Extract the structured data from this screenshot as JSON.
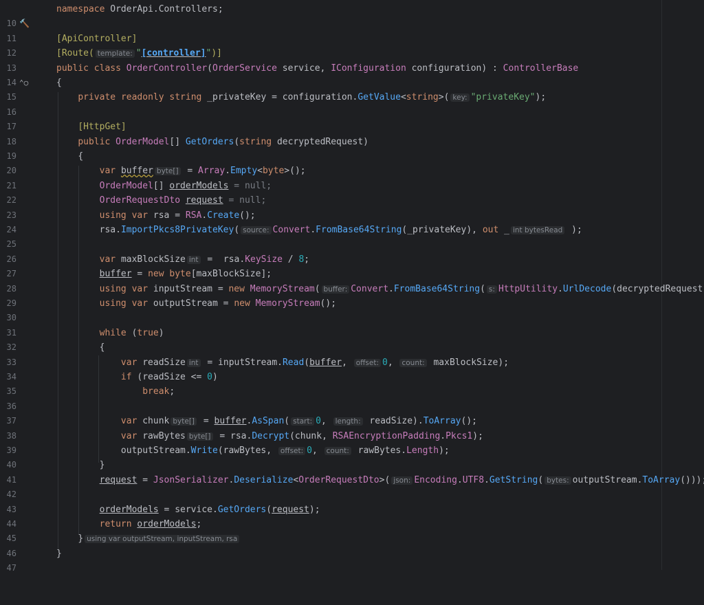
{
  "lines": [
    {
      "n": "10"
    },
    {
      "n": "11"
    },
    {
      "n": "12"
    },
    {
      "n": "13"
    },
    {
      "n": "14"
    },
    {
      "n": "15"
    },
    {
      "n": "16"
    },
    {
      "n": "17"
    },
    {
      "n": "18"
    },
    {
      "n": "19"
    },
    {
      "n": "20"
    },
    {
      "n": "21"
    },
    {
      "n": "22"
    },
    {
      "n": "23"
    },
    {
      "n": "24"
    },
    {
      "n": "25"
    },
    {
      "n": "26"
    },
    {
      "n": "27"
    },
    {
      "n": "28"
    },
    {
      "n": "29"
    },
    {
      "n": "30"
    },
    {
      "n": "31"
    },
    {
      "n": "32"
    },
    {
      "n": "33"
    },
    {
      "n": "34"
    },
    {
      "n": "35"
    },
    {
      "n": "36"
    },
    {
      "n": "37"
    },
    {
      "n": "38"
    },
    {
      "n": "39"
    },
    {
      "n": "40"
    },
    {
      "n": "41"
    },
    {
      "n": "42"
    },
    {
      "n": "43"
    },
    {
      "n": "44"
    },
    {
      "n": "45"
    },
    {
      "n": "46"
    },
    {
      "n": "47"
    }
  ],
  "icons": {
    "hammer": "hammer-icon",
    "override": "override-gutter-icon"
  },
  "t": {
    "namespace": "namespace",
    "ns_name": "OrderApi.Controllers",
    "semi": ";",
    "apicontroller": "[ApiController]",
    "route_open": "[Route(",
    "h_template": "template:",
    "route_str_q1": "\"",
    "route_str": "[controller]",
    "route_str_q2": "\"",
    "route_close": ")]",
    "public": "public",
    "class": "class",
    "controller": "OrderController",
    "p1": "(",
    "orderservice": "OrderService",
    "service": " service, ",
    "iconfig": "IConfiguration",
    "configuration": " configuration) : ",
    "controllerbase": "ControllerBase",
    "brace_open": "{",
    "brace_close": "}",
    "private": "private",
    "readonly": "readonly",
    "string": "string",
    "privkey_field": " _privateKey = configuration.",
    "getvalue": "GetValue",
    "lt": "<",
    "gt": ">(",
    "h_key": "key:",
    "privkey_str": "\"privateKey\"",
    "paren_semi": ");",
    "httpget": "[HttpGet]",
    "ordermodel": "OrderModel",
    "arr": "[] ",
    "getorders": "GetOrders",
    "string2": "string",
    "decrypted_param": " decryptedRequest)",
    "var": "var",
    "buffer": "buffer",
    "h_bytearr": "byte[]",
    "eq": " = ",
    "array": "Array",
    "empty": "Empty",
    "byte": "byte",
    "close_gen": ">();",
    "ordermodels": "orderModels",
    "eq_null": " = null;",
    "orderrequestdto": "OrderRequestDto",
    "request": "request",
    "using": "using",
    "rsa": "rsa",
    "rsa_cls": "RSA",
    "create": "Create",
    "call_semi": "();",
    "importpkcs8": "ImportPkcs8PrivateKey",
    "h_source": "source:",
    "convert": "Convert",
    "frombase64": "FromBase64String",
    "privkey_arg": "(_privateKey), ",
    "out": "out",
    "underscore": " _",
    "h_intbytes": "int bytesRead",
    "close_semi": " );",
    "maxblocksize": "maxBlockSize",
    "h_int": "int",
    "rsa_dot": " rsa.",
    "keysize": "KeySize",
    "div": " / ",
    "eight": "8",
    "new": "new",
    "maxblock_idx": "[maxBlockSize];",
    "inputstream": "inputStream",
    "memorystream": "MemoryStream",
    "h_buffer": "buffer:",
    "h_s": "s:",
    "httputility": "HttpUtility",
    "urldecode": "UrlDecode",
    "decrypted_arg": "(decryptedRequest)));",
    "outputstream": "outputStream",
    "while": "while",
    "true": "true",
    "readsize": "readSize",
    "read": "Read",
    "h_offset": "offset:",
    "zero": "0",
    "h_count": "count:",
    "maxblock_arg": " maxBlockSize);",
    "if": "if",
    "readsize_cmp": "(readSize <= ",
    "break": "break",
    "chunk": "chunk",
    "asspan": "AsSpan",
    "h_start": "start:",
    "h_length": "length:",
    "readsize_arg": " readSize).",
    "toarray": "ToArray",
    "rawbytes": "rawBytes",
    "decrypt": "Decrypt",
    "chunk_arg": "(chunk, ",
    "rsaenc": "RSAEncryptionPadding",
    "pkcs1": "Pkcs1",
    "write": "Write",
    "rawbytes_arg": "(rawBytes, ",
    "length": "Length",
    "jsonser": "JsonSerializer",
    "deserialize": "Deserialize",
    "h_json": "json:",
    "encoding": "Encoding",
    "utf8": "UTF8",
    "getstring": "GetString",
    "h_bytes": "bytes:",
    "outputstream_dot": "outputStream.",
    "service_dot": " = service.",
    "return": "return",
    "using_hint": "using var outputStream, inputStream, rsa"
  }
}
